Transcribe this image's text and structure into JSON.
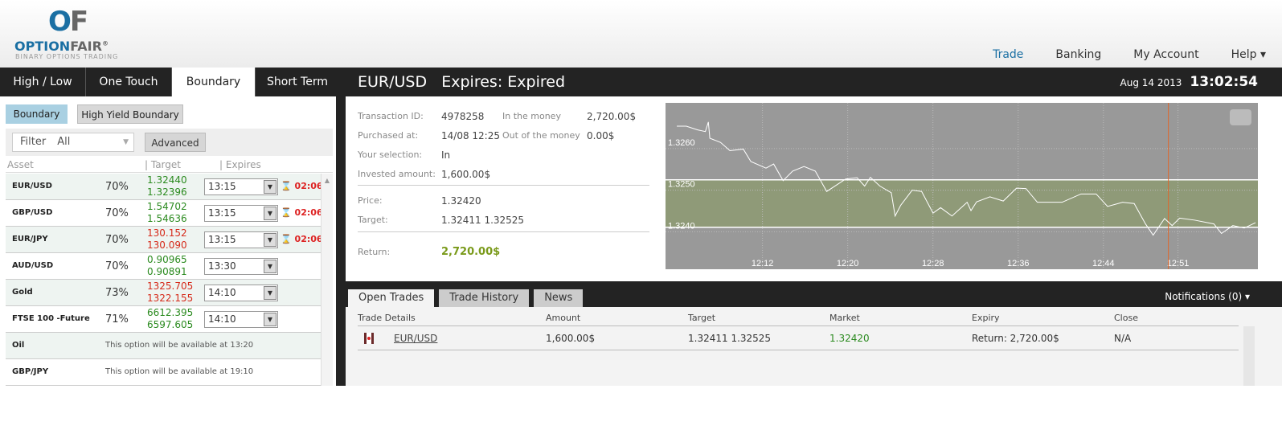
{
  "brand": {
    "logo_mark": "OF",
    "name_part1": "OPTION",
    "name_part2": "FAIR",
    "registered": "®",
    "tagline": "BINARY OPTIONS TRADING"
  },
  "topnav": [
    {
      "label": "Trade"
    },
    {
      "label": "Banking"
    },
    {
      "label": "My Account"
    },
    {
      "label": "Help ▾"
    }
  ],
  "type_tabs": [
    {
      "label": "High / Low"
    },
    {
      "label": "One Touch"
    },
    {
      "label": "Boundary"
    },
    {
      "label": "Short Term"
    }
  ],
  "subtabs": {
    "boundary": "Boundary",
    "high_yield": "High Yield Boundary"
  },
  "filter": {
    "label": "Filter",
    "value": "All",
    "advanced": "Advanced"
  },
  "asset_columns": {
    "asset": "Asset",
    "target": "Target",
    "expires": "Expires"
  },
  "assets": [
    {
      "name": "EUR/USD",
      "payout": "70%",
      "t1": "1.32440",
      "t2": "1.32396",
      "dir": "up",
      "expiry": "13:15",
      "timer": "02:06"
    },
    {
      "name": "GBP/USD",
      "payout": "70%",
      "t1": "1.54702",
      "t2": "1.54636",
      "dir": "up",
      "expiry": "13:15",
      "timer": "02:06"
    },
    {
      "name": "EUR/JPY",
      "payout": "70%",
      "t1": "130.152",
      "t2": "130.090",
      "dir": "dn",
      "expiry": "13:15",
      "timer": "02:06"
    },
    {
      "name": "AUD/USD",
      "payout": "70%",
      "t1": "0.90965",
      "t2": "0.90891",
      "dir": "up",
      "expiry": "13:30"
    },
    {
      "name": "Gold",
      "payout": "73%",
      "t1": "1325.705",
      "t2": "1322.155",
      "dir": "dn",
      "expiry": "14:10"
    },
    {
      "name": "FTSE 100 -Future",
      "payout": "71%",
      "t1": "6612.395",
      "t2": "6597.605",
      "dir": "up",
      "expiry": "14:10"
    },
    {
      "name": "Oil",
      "message": "This option will be available at 13:20"
    },
    {
      "name": "GBP/JPY",
      "message": "This option will be available at 19:10"
    }
  ],
  "asset_header": {
    "pair": "EUR/USD",
    "expires_label": "Expires:",
    "expires_value": "Expired",
    "date": "Aug 14 2013",
    "time": "13:02:54"
  },
  "details": {
    "transaction_id_label": "Transaction ID:",
    "transaction_id": "4978258",
    "purchased_label": "Purchased at:",
    "purchased": "14/08 12:25",
    "selection_label": "Your selection:",
    "selection": "In",
    "invested_label": "Invested amount:",
    "invested": "1,600.00$",
    "in_money_label": "In the money",
    "in_money": "2,720.00$",
    "out_money_label": "Out of the money",
    "out_money": "0.00$",
    "price_label": "Price:",
    "price": "1.32420",
    "target_label": "Target:",
    "target": "1.32411 1.32525",
    "return_label": "Return:",
    "return": "2,720.00$"
  },
  "chart_data": {
    "type": "line",
    "title": "",
    "xlabel": "",
    "ylabel": "",
    "x_unit": "minutes after 12:00",
    "xlim": [
      2.9,
      58.5
    ],
    "ylim": [
      1.3231,
      1.3271
    ],
    "x_ticks": [
      {
        "x": 12,
        "label": "12:12"
      },
      {
        "x": 20,
        "label": "12:20"
      },
      {
        "x": 28,
        "label": "12:28"
      },
      {
        "x": 36,
        "label": "12:36"
      },
      {
        "x": 44,
        "label": "12:44"
      },
      {
        "x": 51,
        "label": "12:51"
      }
    ],
    "y_ticks": [
      {
        "y": 1.326,
        "label": "1.3260"
      },
      {
        "y": 1.325,
        "label": "1.3250"
      },
      {
        "y": 1.324,
        "label": "1.3240"
      }
    ],
    "band": [
      1.32411,
      1.32525
    ],
    "marker_x": 50.1,
    "colors": {
      "bg": "#999999",
      "band": "#8f9a78",
      "line": "#ffffff",
      "marker": "#e0662a"
    },
    "x": [
      3.96,
      4.85,
      5.92,
      6.64,
      6.92,
      7.06,
      8.06,
      8.95,
      10.2,
      10.91,
      12.33,
      13.05,
      13.94,
      14.83,
      15.9,
      16.96,
      18.03,
      19.81,
      20.88,
      21.59,
      22.13,
      23.02,
      24.09,
      24.45,
      24.98,
      26.05,
      26.94,
      28.01,
      28.72,
      29.79,
      31.21,
      31.57,
      32.1,
      33.35,
      34.6,
      35.84,
      36.73,
      37.8,
      40.12,
      41.9,
      43.32,
      44.39,
      45.82,
      46.89,
      47.95,
      48.67,
      49.74,
      50.45,
      51.16,
      52.58,
      54.37,
      55.08,
      56.15,
      57.22,
      58.28
    ],
    "y": [
      1.32654,
      1.32654,
      1.32645,
      1.32641,
      1.32664,
      1.32625,
      1.32615,
      1.32595,
      1.32599,
      1.32569,
      1.32553,
      1.32563,
      1.32523,
      1.32546,
      1.32557,
      1.32546,
      1.32497,
      1.32527,
      1.3253,
      1.3251,
      1.32531,
      1.3251,
      1.32494,
      1.32438,
      1.32464,
      1.325,
      1.32497,
      1.32445,
      1.32458,
      1.32438,
      1.32471,
      1.32451,
      1.32472,
      1.32484,
      1.32474,
      1.32505,
      1.32504,
      1.32471,
      1.32471,
      1.32491,
      1.32491,
      1.32461,
      1.32471,
      1.32468,
      1.32419,
      1.32392,
      1.32432,
      1.32415,
      1.32433,
      1.32428,
      1.32419,
      1.32396,
      1.32415,
      1.32409,
      1.32422
    ]
  },
  "bottom_tabs": [
    {
      "label": "Open Trades"
    },
    {
      "label": "Trade History"
    },
    {
      "label": "News"
    }
  ],
  "notifications": "Notifications (0) ▾",
  "trade_columns": [
    "Trade Details",
    "Amount",
    "Target",
    "Market",
    "Expiry",
    "Close"
  ],
  "trade_row": {
    "asset": "EUR/USD",
    "amount": "1,600.00$",
    "target": "1.32411 1.32525",
    "market": "1.32420",
    "expiry": "Return: 2,720.00$",
    "close": "N/A"
  }
}
